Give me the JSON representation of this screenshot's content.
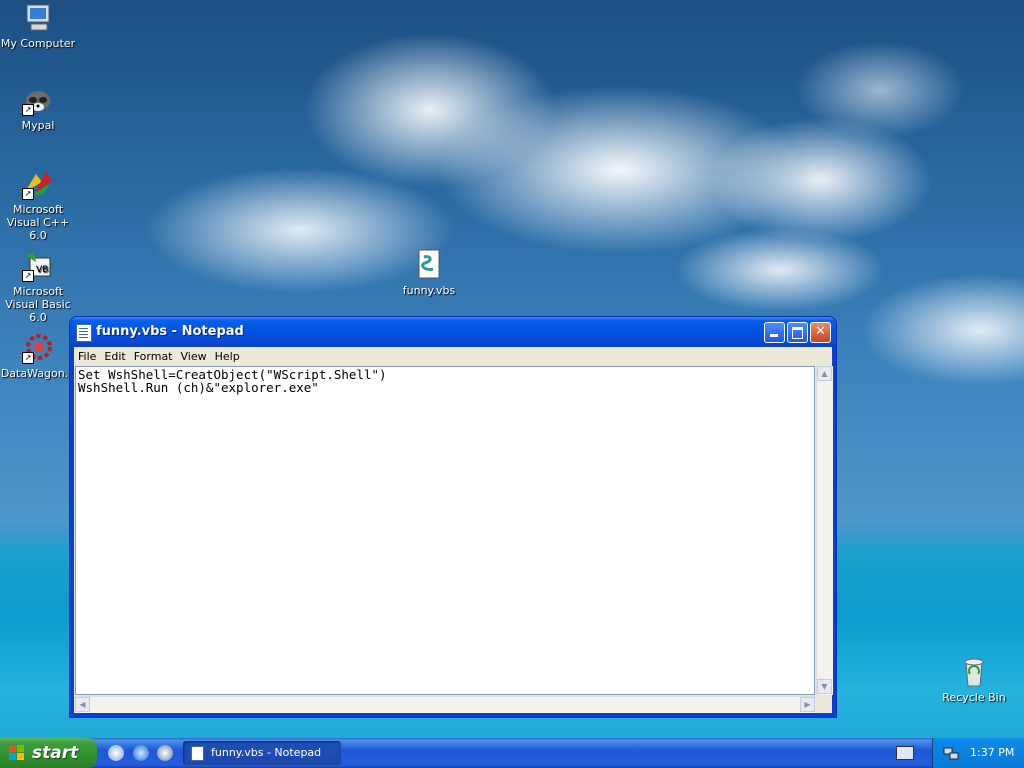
{
  "desktop": {
    "icons": [
      {
        "label": "My Computer"
      },
      {
        "label": "Mypal"
      },
      {
        "label": "Microsoft Visual C++ 6.0"
      },
      {
        "label": "Microsoft Visual Basic 6.0"
      },
      {
        "label": "DataWagon..."
      },
      {
        "label": "funny.vbs"
      },
      {
        "label": "Recycle Bin"
      }
    ]
  },
  "window": {
    "title": "funny.vbs - Notepad",
    "menu": [
      "File",
      "Edit",
      "Format",
      "View",
      "Help"
    ],
    "content": "Set WshShell=CreatObject(\"WScript.Shell\")\nWshShell.Run (ch)&\"explorer.exe\""
  },
  "taskbar": {
    "start_label": "start",
    "task_label": "funny.vbs - Notepad",
    "clock": "1:37 PM"
  }
}
